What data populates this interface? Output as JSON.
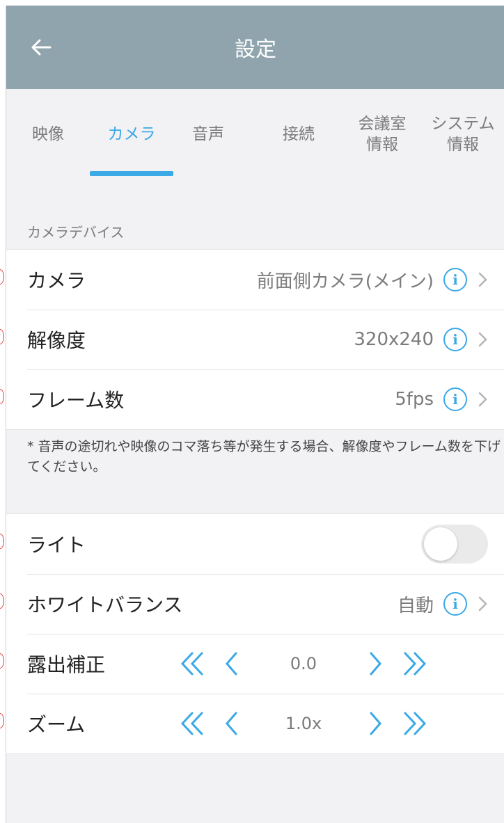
{
  "header": {
    "title": "設定"
  },
  "tabs": [
    {
      "label": "映像",
      "active": false
    },
    {
      "label": "カメラ",
      "active": true
    },
    {
      "label": "音声",
      "active": false
    },
    {
      "label": "接続",
      "active": false
    },
    {
      "label": "会議室\n情報",
      "active": false
    },
    {
      "label": "システム\n情報",
      "active": false
    }
  ],
  "camera_section": {
    "heading": "カメラデバイス",
    "rows": [
      {
        "label": "カメラ",
        "value": "前面側カメラ(メイン)"
      },
      {
        "label": "解像度",
        "value": "320x240"
      },
      {
        "label": "フレーム数",
        "value": "5fps"
      }
    ],
    "note": "* 音声の途切れや映像のコマ落ち等が発生する場合、解像度やフレーム数を下げてください。"
  },
  "adjust_section": {
    "light": {
      "label": "ライト",
      "on": false
    },
    "white_balance": {
      "label": "ホワイトバランス",
      "value": "自動"
    },
    "exposure": {
      "label": "露出補正",
      "value": "0.0"
    },
    "zoom": {
      "label": "ズーム",
      "value": "1.0x"
    }
  },
  "colors": {
    "accent": "#3aa9e6",
    "header_bg": "#8fa4ad",
    "page_bg": "#f2f2f5"
  },
  "icons": {
    "info": "info-icon",
    "chevron": "chevron-right-icon",
    "back": "arrow-left-icon",
    "double_left": "double-chevron-left-icon",
    "left": "chevron-left-icon",
    "right": "chevron-right-icon",
    "double_right": "double-chevron-right-icon"
  }
}
